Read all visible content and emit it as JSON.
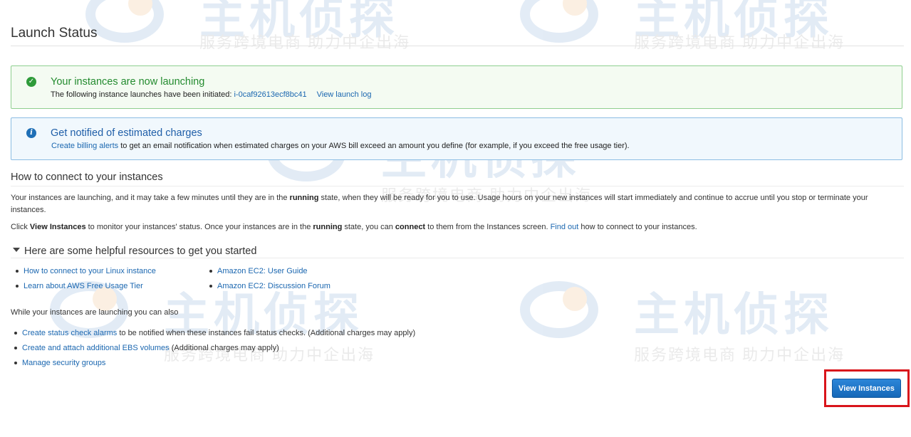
{
  "page": {
    "title": "Launch Status"
  },
  "watermark": {
    "brand": "主机侦探",
    "slogan": "服务跨境电商 助力中企出海"
  },
  "success_alert": {
    "icon": "check-circle-icon",
    "heading": "Your instances are now launching",
    "body_text": "The following instance launches have been initiated:",
    "instance_id": "i-0caf92613ecf8bc41",
    "view_log_link": "View launch log"
  },
  "info_alert": {
    "icon": "info-circle-icon",
    "heading": "Get notified of estimated charges",
    "billing_link": "Create billing alerts",
    "body_text": "to get an email notification when estimated charges on your AWS bill exceed an amount you define (for example, if you exceed the free usage tier)."
  },
  "connect_section": {
    "title": "How to connect to your instances",
    "p1_before": "Your instances are launching, and it may take a few minutes until they are in the ",
    "p1_bold": "running",
    "p1_after": " state, when they will be ready for you to use. Usage hours on your new instances will start immediately and continue to accrue until you stop or terminate your instances.",
    "p2_lead": "Click ",
    "p2_bold1": "View Instances",
    "p2_mid1": " to monitor your instances' status. Once your instances are in the ",
    "p2_bold2": "running",
    "p2_mid2": " state, you can ",
    "p2_bold3": "connect",
    "p2_mid3": " to them from the Instances screen. ",
    "p2_link": "Find out",
    "p2_after": " how to connect to your instances."
  },
  "resources": {
    "toggle_label": "Here are some helpful resources to get you started",
    "col1": [
      {
        "label": "How to connect to your Linux instance"
      },
      {
        "label": "Learn about AWS Free Usage Tier"
      }
    ],
    "col2": [
      {
        "label": "Amazon EC2: User Guide"
      },
      {
        "label": "Amazon EC2: Discussion Forum"
      }
    ]
  },
  "while_launching": {
    "label": "While your instances are launching you can also",
    "items": [
      {
        "link": "Create status check alarms",
        "suffix": " to be notified when these instances fail status checks. (Additional charges may apply)"
      },
      {
        "link": "Create and attach additional EBS volumes",
        "suffix": " (Additional charges may apply)"
      },
      {
        "link": "Manage security groups",
        "suffix": ""
      }
    ]
  },
  "actions": {
    "view_instances_label": "View Instances"
  },
  "colors": {
    "success_green": "#238b2f",
    "info_blue": "#1f5ea8",
    "link_blue": "#1b67b0",
    "primary_button": "#1a73c9",
    "highlight_red": "#d9141b"
  }
}
